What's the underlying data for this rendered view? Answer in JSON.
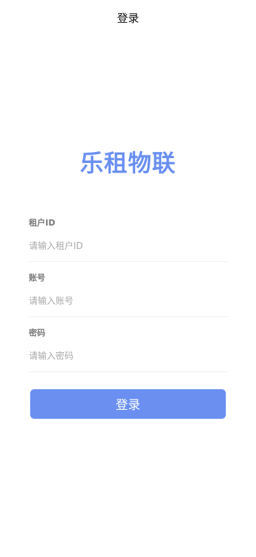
{
  "nav": {
    "title": "登录"
  },
  "brand": {
    "name": "乐租物联"
  },
  "form": {
    "tenant": {
      "label": "租户ID",
      "placeholder": "请输入租户ID",
      "value": ""
    },
    "account": {
      "label": "账号",
      "placeholder": "请输入账号",
      "value": ""
    },
    "password": {
      "label": "密码",
      "placeholder": "请输入密码",
      "value": ""
    },
    "submit_label": "登录"
  },
  "colors": {
    "accent": "#6a8ff0",
    "label": "#7a7a7a",
    "placeholder": "#a9a9a9",
    "divider": "#efefef"
  }
}
